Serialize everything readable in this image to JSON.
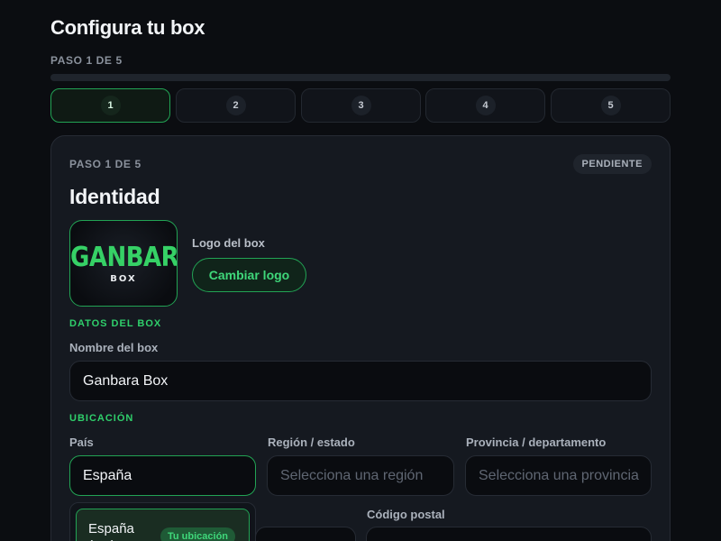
{
  "header": {
    "title": "Configura tu box",
    "step_caption": "PASO 1 DE 5",
    "progress": 0.0
  },
  "steps": [
    {
      "label": "1",
      "active": true
    },
    {
      "label": "2",
      "active": false
    },
    {
      "label": "3",
      "active": false
    },
    {
      "label": "4",
      "active": false
    },
    {
      "label": "5",
      "active": false
    }
  ],
  "card": {
    "step_caption": "PASO 1 DE 5",
    "status_badge": "PENDIENTE",
    "title": "Identidad",
    "logo": {
      "brand_text": "GANBARA",
      "brand_subtext": "BOX",
      "label": "Logo del box",
      "change_button": "Cambiar logo"
    },
    "box_section": {
      "heading": "DATOS DEL BOX",
      "name_label": "Nombre del box",
      "name_value": "Ganbara Box"
    },
    "location_section": {
      "heading": "UBICACIÓN",
      "country_label": "País",
      "country_value": "España",
      "region_label": "Región / estado",
      "region_placeholder": "Selecciona una región",
      "province_label": "Provincia / departamento",
      "province_placeholder": "Selecciona una provincia",
      "postal_label": "Código postal",
      "postal_value": ""
    },
    "country_dropdown": {
      "options": [
        {
          "label": "España (ES)",
          "badge": "Tu ubicación",
          "highlighted": true
        }
      ]
    }
  },
  "colors": {
    "background": "#0b0d11",
    "card": "#151920",
    "accent": "#22c55e",
    "accent_text": "#3fd77a"
  }
}
